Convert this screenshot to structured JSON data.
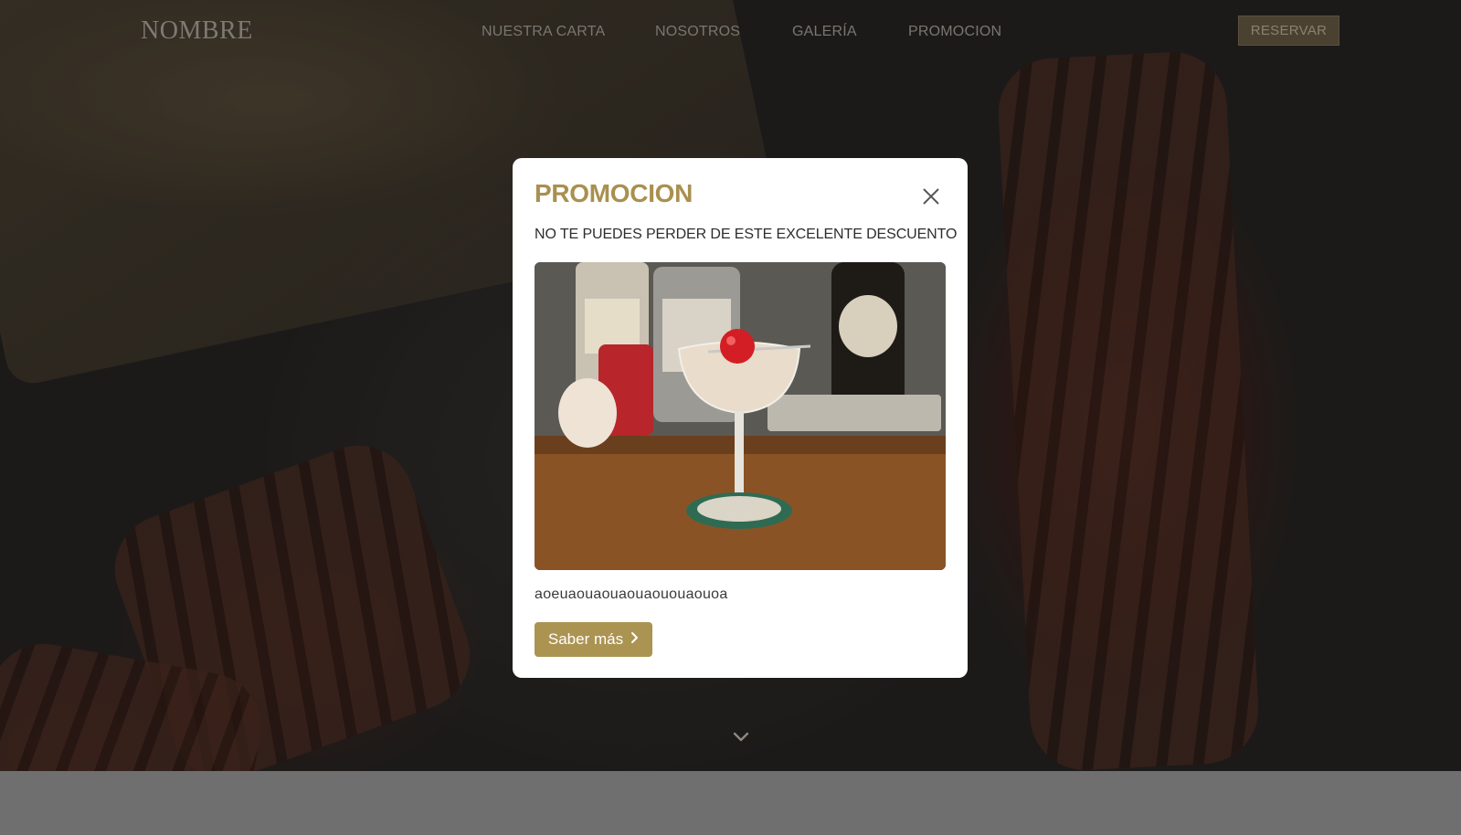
{
  "nav": {
    "logo": "NOMBRE",
    "links": [
      "NUESTRA CARTA",
      "NOSOTROS",
      "GALERÍA",
      "PROMOCION"
    ],
    "reserve_label": "RESERVAR"
  },
  "modal": {
    "title": "PROMOCION",
    "subtitle": "NO TE PUEDES PERDER DE ESTE EXCELENTE DESCUENTO",
    "body_text": "aoeuaouaouaouaououaouoa",
    "more_label": "Saber más",
    "image_alt": "cocktail"
  },
  "colors": {
    "accent": "#ab9352",
    "title": "#a9904e",
    "overlay": "#2a2826"
  },
  "icons": {
    "close": "close-icon",
    "chevron_right": "chevron-right-icon",
    "chevron_down": "chevron-down-icon"
  }
}
